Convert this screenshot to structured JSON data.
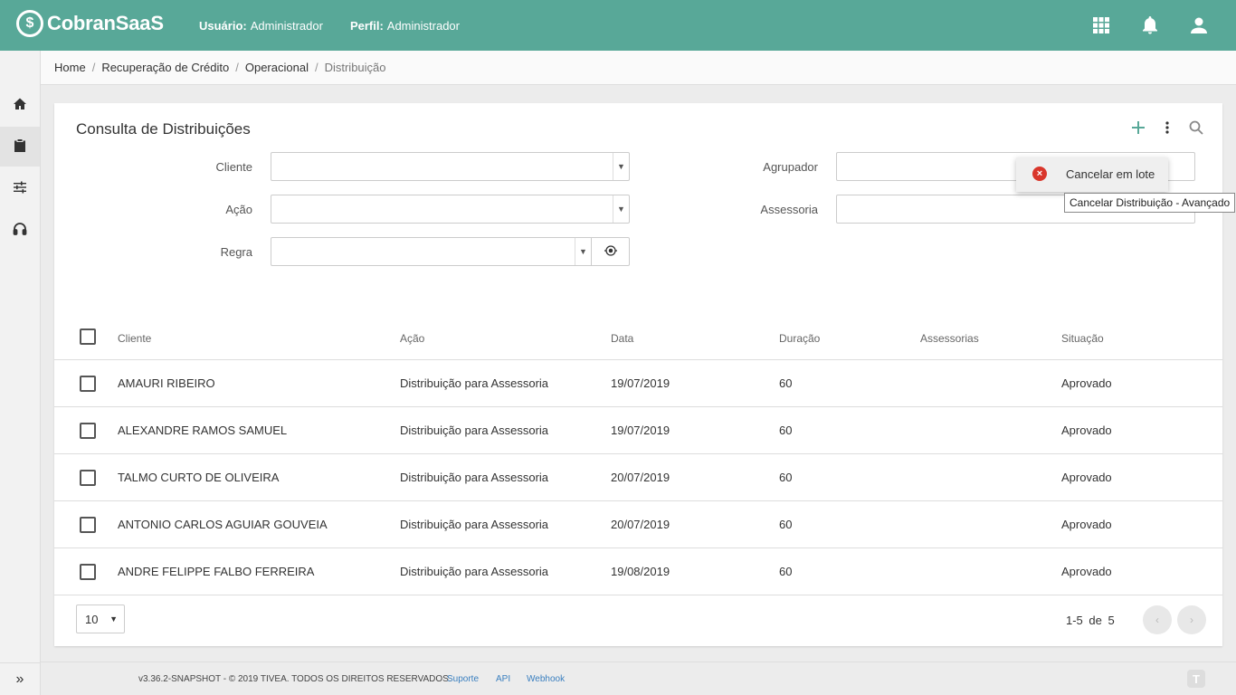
{
  "header": {
    "logo_mark": "$",
    "brand": "CobranSaaS",
    "user_label": "Usuário:",
    "user_value": "Administrador",
    "profile_label": "Perfil:",
    "profile_value": "Administrador",
    "icons": [
      "apps-grid-icon",
      "bell-icon",
      "user-icon"
    ]
  },
  "sidebar": {
    "items": [
      "home-icon",
      "clipboard-icon",
      "sliders-icon",
      "headset-icon"
    ],
    "active": "clipboard-icon",
    "expand_label": "»"
  },
  "breadcrumb": {
    "items": [
      "Home",
      "Recuperação de Crédito",
      "Operacional",
      "Distribuição"
    ],
    "separator": "/"
  },
  "page": {
    "title": "Consulta de Distribuições",
    "actions": [
      "add-icon",
      "more-vertical-icon",
      "search-icon"
    ]
  },
  "filters": {
    "cliente_label": "Cliente",
    "acao_label": "Ação",
    "regra_label": "Regra",
    "agrupador_label": "Agrupador",
    "assessoria_label": "Assessoria",
    "cliente_value": "",
    "acao_value": "",
    "regra_value": "",
    "agrupador_value": "",
    "assessoria_value": ""
  },
  "table": {
    "columns": [
      "Cliente",
      "Ação",
      "Data",
      "Duração",
      "Assessorias",
      "Situação"
    ],
    "rows": [
      {
        "cliente": "AMAURI RIBEIRO",
        "acao": "Distribuição para Assessoria",
        "data": "19/07/2019",
        "duracao": "60",
        "assessorias": "",
        "situacao": "Aprovado"
      },
      {
        "cliente": "ALEXANDRE RAMOS SAMUEL",
        "acao": "Distribuição para Assessoria",
        "data": "19/07/2019",
        "duracao": "60",
        "assessorias": "",
        "situacao": "Aprovado"
      },
      {
        "cliente": "TALMO CURTO DE OLIVEIRA",
        "acao": "Distribuição para Assessoria",
        "data": "20/07/2019",
        "duracao": "60",
        "assessorias": "",
        "situacao": "Aprovado"
      },
      {
        "cliente": "ANTONIO CARLOS AGUIAR GOUVEIA",
        "acao": "Distribuição para Assessoria",
        "data": "20/07/2019",
        "duracao": "60",
        "assessorias": "",
        "situacao": "Aprovado"
      },
      {
        "cliente": "ANDRE FELIPPE FALBO FERREIRA",
        "acao": "Distribuição para Assessoria",
        "data": "19/08/2019",
        "duracao": "60",
        "assessorias": "",
        "situacao": "Aprovado"
      }
    ]
  },
  "pagination": {
    "page_size": "10",
    "range": "1-5",
    "of_label": "de",
    "total": "5",
    "prev_label": "‹",
    "next_label": "›"
  },
  "menu": {
    "item_label": "Cancelar em lote",
    "item_icon": "cancel-circle-icon",
    "tooltip": "Cancelar Distribuição - Avançado"
  },
  "footer": {
    "copyright": "v3.36.2-SNAPSHOT - © 2019 TIVEA. TODOS OS DIREITOS RESERVADOS.",
    "links": [
      "Suporte",
      "API",
      "Webhook"
    ],
    "logo_mark": "T"
  },
  "colors": {
    "primary": "#58a898",
    "danger": "#d9362b",
    "link": "#3a7fbf"
  }
}
